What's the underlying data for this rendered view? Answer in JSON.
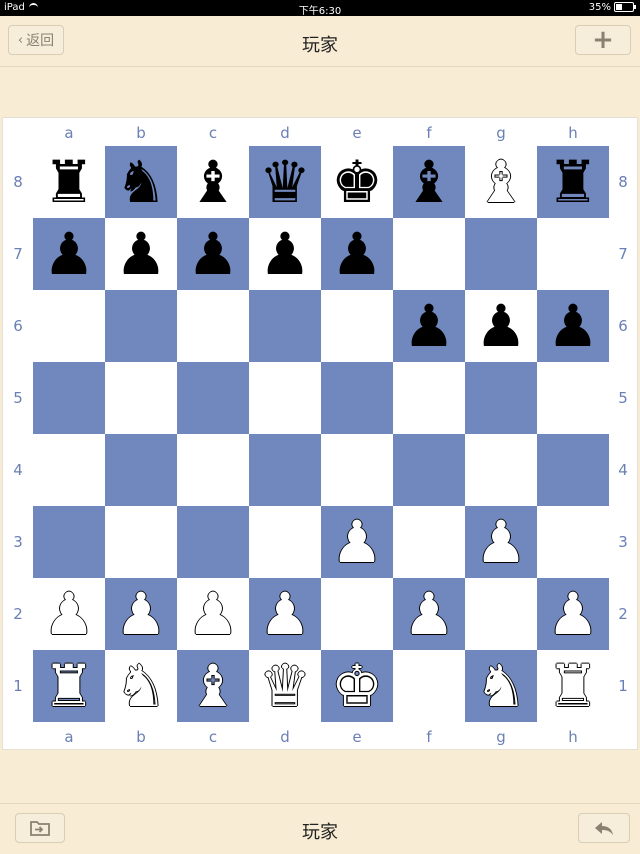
{
  "status": {
    "device": "iPad",
    "time": "下午6:30",
    "battery": "35%"
  },
  "nav": {
    "back_label": "返回",
    "title": "玩家",
    "add_label": "+"
  },
  "bottom": {
    "title": "玩家"
  },
  "board": {
    "files": [
      "a",
      "b",
      "c",
      "d",
      "e",
      "f",
      "g",
      "h"
    ],
    "ranks": [
      "8",
      "7",
      "6",
      "5",
      "4",
      "3",
      "2",
      "1"
    ],
    "position": [
      [
        "br",
        "bn",
        "bb",
        "bq",
        "bk",
        "bb",
        "wb",
        "br"
      ],
      [
        "bp",
        "bp",
        "bp",
        "bp",
        "bp",
        "",
        "",
        ""
      ],
      [
        "",
        "",
        "",
        "",
        "",
        "bp",
        "bp",
        "bp"
      ],
      [
        "",
        "",
        "",
        "",
        "",
        "",
        "",
        ""
      ],
      [
        "",
        "",
        "",
        "",
        "",
        "",
        "",
        ""
      ],
      [
        "",
        "",
        "",
        "",
        "wp",
        "",
        "wp",
        ""
      ],
      [
        "wp",
        "wp",
        "wp",
        "wp",
        "",
        "wp",
        "",
        "wp"
      ],
      [
        "wr",
        "wn",
        "wb",
        "wq",
        "wk",
        "",
        "wn",
        "wr"
      ]
    ],
    "colors": {
      "light": "#ffffff",
      "dark": "#7088bd"
    }
  }
}
